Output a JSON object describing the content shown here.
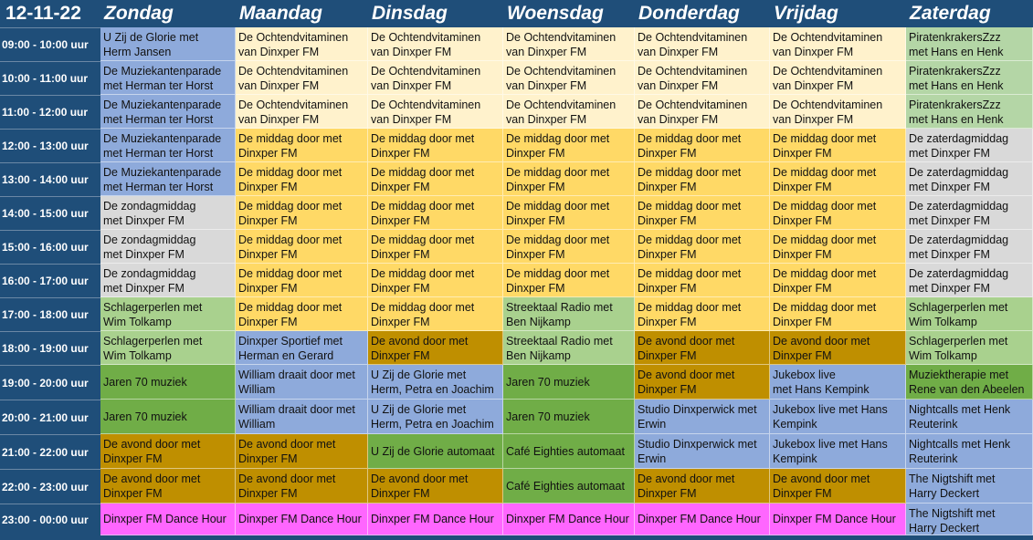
{
  "header": {
    "date": "12-11-22",
    "days": [
      "Zondag",
      "Maandag",
      "Dinsdag",
      "Woensdag",
      "Donderdag",
      "Vrijdag",
      "Zaterdag"
    ]
  },
  "colors": {
    "header_bg": "#1f4e79",
    "blue": "#8eaadb",
    "cream": "#fff2cc",
    "teal": "#b4d6a6",
    "yellow": "#ffd966",
    "gray": "#d9d9d9",
    "lightgreen": "#a9d18e",
    "green": "#70ad47",
    "brown": "#bf8f00",
    "magenta": "#ff66ff"
  },
  "times": [
    "09:00 - 10:00 uur",
    "10:00 - 11:00 uur",
    "11:00 - 12:00 uur",
    "12:00 - 13:00 uur",
    "13:00 - 14:00 uur",
    "14:00 - 15:00 uur",
    "15:00 - 16:00 uur",
    "16:00 - 17:00 uur",
    "17:00 - 18:00 uur",
    "18:00 - 19:00 uur",
    "19:00 - 20:00 uur",
    "20:00 - 21:00 uur",
    "21:00 - 22:00 uur",
    "22:00 - 23:00 uur",
    "23:00 - 00:00 uur"
  ],
  "schedule": [
    [
      {
        "text": "U Zij de Glorie  met\nHerm Jansen",
        "color": "blue"
      },
      {
        "text": "De Ochtendvitaminen\nvan  Dinxper FM",
        "color": "cream"
      },
      {
        "text": "De Ochtendvitaminen\nvan  Dinxper FM",
        "color": "cream"
      },
      {
        "text": "De Ochtendvitaminen\nvan  Dinxper FM",
        "color": "cream"
      },
      {
        "text": "De Ochtendvitaminen\nvan  Dinxper FM",
        "color": "cream"
      },
      {
        "text": "De Ochtendvitaminen\nvan  Dinxper FM",
        "color": "cream"
      },
      {
        "text": "PiratenkrakersZzz\nmet   Hans  en Henk",
        "color": "teal"
      }
    ],
    [
      {
        "text": "De Muziekantenparade\nmet Herman ter Horst",
        "color": "blue"
      },
      {
        "text": "De Ochtendvitaminen\nvan  Dinxper FM",
        "color": "cream"
      },
      {
        "text": "De Ochtendvitaminen\nvan  Dinxper FM",
        "color": "cream"
      },
      {
        "text": "De Ochtendvitaminen\nvan  Dinxper FM",
        "color": "cream"
      },
      {
        "text": "De Ochtendvitaminen\nvan  Dinxper FM",
        "color": "cream"
      },
      {
        "text": "De Ochtendvitaminen\nvan  Dinxper FM",
        "color": "cream"
      },
      {
        "text": "PiratenkrakersZzz\nmet   Hans  en Henk",
        "color": "teal"
      }
    ],
    [
      {
        "text": "De Muziekantenparade\nmet Herman ter Horst",
        "color": "blue"
      },
      {
        "text": "De Ochtendvitaminen\nvan  Dinxper FM",
        "color": "cream"
      },
      {
        "text": "De Ochtendvitaminen\nvan  Dinxper FM",
        "color": "cream"
      },
      {
        "text": "De Ochtendvitaminen\nvan  Dinxper FM",
        "color": "cream"
      },
      {
        "text": "De Ochtendvitaminen\nvan  Dinxper FM",
        "color": "cream"
      },
      {
        "text": "De Ochtendvitaminen\nvan  Dinxper FM",
        "color": "cream"
      },
      {
        "text": "PiratenkrakersZzz\nmet   Hans  en Henk",
        "color": "teal"
      }
    ],
    [
      {
        "text": "De Muziekantenparade\nmet Herman ter Horst",
        "color": "blue"
      },
      {
        "text": "De middag door met\nDinxper FM",
        "color": "yellow"
      },
      {
        "text": "De middag door met\nDinxper FM",
        "color": "yellow"
      },
      {
        "text": "De middag door met\nDinxper FM",
        "color": "yellow"
      },
      {
        "text": "De middag door met\nDinxper FM",
        "color": "yellow"
      },
      {
        "text": "De middag door met\nDinxper FM",
        "color": "yellow"
      },
      {
        "text": "De zaterdagmiddag\nmet Dinxper FM",
        "color": "gray"
      }
    ],
    [
      {
        "text": "De Muziekantenparade\nmet Herman ter Horst",
        "color": "blue"
      },
      {
        "text": "De middag door met\nDinxper FM",
        "color": "yellow"
      },
      {
        "text": "De middag door met\nDinxper FM",
        "color": "yellow"
      },
      {
        "text": "De middag door met\nDinxper FM",
        "color": "yellow"
      },
      {
        "text": "De middag door met\nDinxper FM",
        "color": "yellow"
      },
      {
        "text": "De middag door met\nDinxper FM",
        "color": "yellow"
      },
      {
        "text": "De zaterdagmiddag\nmet Dinxper FM",
        "color": "gray"
      }
    ],
    [
      {
        "text": "De zondagmiddag\nmet Dinxper FM",
        "color": "gray"
      },
      {
        "text": "De middag door met\nDinxper FM",
        "color": "yellow"
      },
      {
        "text": "De middag door met\nDinxper FM",
        "color": "yellow"
      },
      {
        "text": "De middag door met\nDinxper FM",
        "color": "yellow"
      },
      {
        "text": "De middag door met\nDinxper FM",
        "color": "yellow"
      },
      {
        "text": "De middag door met\nDinxper FM",
        "color": "yellow"
      },
      {
        "text": "De zaterdagmiddag\nmet Dinxper FM",
        "color": "gray"
      }
    ],
    [
      {
        "text": "De zondagmiddag\nmet Dinxper FM",
        "color": "gray"
      },
      {
        "text": "De middag door met\nDinxper FM",
        "color": "yellow"
      },
      {
        "text": "De middag door met\nDinxper FM",
        "color": "yellow"
      },
      {
        "text": "De middag door met\nDinxper FM",
        "color": "yellow"
      },
      {
        "text": "De middag door met\nDinxper FM",
        "color": "yellow"
      },
      {
        "text": "De middag door met\nDinxper FM",
        "color": "yellow"
      },
      {
        "text": "De zaterdagmiddag\nmet Dinxper FM",
        "color": "gray"
      }
    ],
    [
      {
        "text": "De zondagmiddag\nmet Dinxper FM",
        "color": "gray"
      },
      {
        "text": "De middag door met\nDinxper FM",
        "color": "yellow"
      },
      {
        "text": "De middag door met\nDinxper FM",
        "color": "yellow"
      },
      {
        "text": "De middag door met\nDinxper FM",
        "color": "yellow"
      },
      {
        "text": "De middag door met\nDinxper FM",
        "color": "yellow"
      },
      {
        "text": "De middag door met\nDinxper FM",
        "color": "yellow"
      },
      {
        "text": "De zaterdagmiddag\nmet Dinxper FM",
        "color": "gray"
      }
    ],
    [
      {
        "text": "Schlagerperlen met\nWim Tolkamp",
        "color": "lightgreen"
      },
      {
        "text": "De middag door met\nDinxper FM",
        "color": "yellow"
      },
      {
        "text": "De middag door met\nDinxper FM",
        "color": "yellow"
      },
      {
        "text": "Streektaal Radio met\nBen Nijkamp",
        "color": "lightgreen"
      },
      {
        "text": "De middag door met\nDinxper FM",
        "color": "yellow"
      },
      {
        "text": "De middag door met\nDinxper FM",
        "color": "yellow"
      },
      {
        "text": "Schlagerperlen met\nWim Tolkamp",
        "color": "lightgreen"
      }
    ],
    [
      {
        "text": "Schlagerperlen met\nWim Tolkamp",
        "color": "lightgreen"
      },
      {
        "text": "Dinxper Sportief  met\nHerman en Gerard",
        "color": "blue"
      },
      {
        "text": "De avond door met\nDinxper FM",
        "color": "brown"
      },
      {
        "text": "Streektaal Radio met\nBen Nijkamp",
        "color": "lightgreen"
      },
      {
        "text": "De avond door met\nDinxper FM",
        "color": "brown"
      },
      {
        "text": "De avond door met\nDinxper FM",
        "color": "brown"
      },
      {
        "text": "Schlagerperlen met\nWim Tolkamp",
        "color": "lightgreen"
      }
    ],
    [
      {
        "text": "Jaren 70 muziek",
        "color": "green",
        "mid": true
      },
      {
        "text": "William draait door met\nWilliam",
        "color": "blue"
      },
      {
        "text": "U Zij de Glorie met\nHerm, Petra en Joachim",
        "color": "blue"
      },
      {
        "text": "Jaren 70 muziek",
        "color": "green",
        "mid": true
      },
      {
        "text": "De avond door met\nDinxper FM",
        "color": "brown"
      },
      {
        "text": "Jukebox live\nmet  Hans Kempink",
        "color": "blue"
      },
      {
        "text": "Muziektherapie met\nRene van den Abeelen",
        "color": "green"
      }
    ],
    [
      {
        "text": "Jaren 70 muziek",
        "color": "green",
        "mid": true
      },
      {
        "text": "William draait door met\nWilliam",
        "color": "blue"
      },
      {
        "text": "U Zij de Glorie met\nHerm, Petra en Joachim",
        "color": "blue"
      },
      {
        "text": "Jaren 70 muziek",
        "color": "green",
        "mid": true
      },
      {
        "text": "Studio Dinxperwick  met\nErwin",
        "color": "blue"
      },
      {
        "text": "Jukebox live  met  Hans\nKempink",
        "color": "blue"
      },
      {
        "text": "Nightcalls  met  Henk\nReuterink",
        "color": "blue"
      }
    ],
    [
      {
        "text": "De avond door met\nDinxper FM",
        "color": "brown"
      },
      {
        "text": "De avond door met\nDinxper FM",
        "color": "brown"
      },
      {
        "text": "U Zij de Glorie automaat",
        "color": "green",
        "mid": true
      },
      {
        "text": "Café Eighties automaat",
        "color": "green",
        "mid": true
      },
      {
        "text": "Studio Dinxperwick  met\nErwin",
        "color": "blue"
      },
      {
        "text": "Jukebox live  met  Hans\nKempink",
        "color": "blue"
      },
      {
        "text": "Nightcalls  met  Henk\nReuterink",
        "color": "blue"
      }
    ],
    [
      {
        "text": "De avond door met\nDinxper FM",
        "color": "brown"
      },
      {
        "text": "De avond door met\nDinxper FM",
        "color": "brown"
      },
      {
        "text": "De avond door met\nDinxper FM",
        "color": "brown"
      },
      {
        "text": "Café Eighties automaat",
        "color": "green",
        "mid": true
      },
      {
        "text": "De avond door met\nDinxper FM",
        "color": "brown"
      },
      {
        "text": "De avond door met\nDinxper FM",
        "color": "brown"
      },
      {
        "text": "The Nigtshift  met\nHarry Deckert",
        "color": "blue"
      }
    ],
    [
      {
        "text": "Dinxper FM Dance Hour",
        "color": "magenta",
        "mid": true
      },
      {
        "text": "Dinxper FM Dance Hour",
        "color": "magenta",
        "mid": true
      },
      {
        "text": "Dinxper FM Dance Hour",
        "color": "magenta",
        "mid": true
      },
      {
        "text": "Dinxper FM Dance Hour",
        "color": "magenta",
        "mid": true
      },
      {
        "text": "Dinxper FM Dance Hour",
        "color": "magenta",
        "mid": true
      },
      {
        "text": "Dinxper FM Dance Hour",
        "color": "magenta",
        "mid": true
      },
      {
        "text": "The Nigtshift  met\nHarry Deckert",
        "color": "blue"
      }
    ]
  ]
}
